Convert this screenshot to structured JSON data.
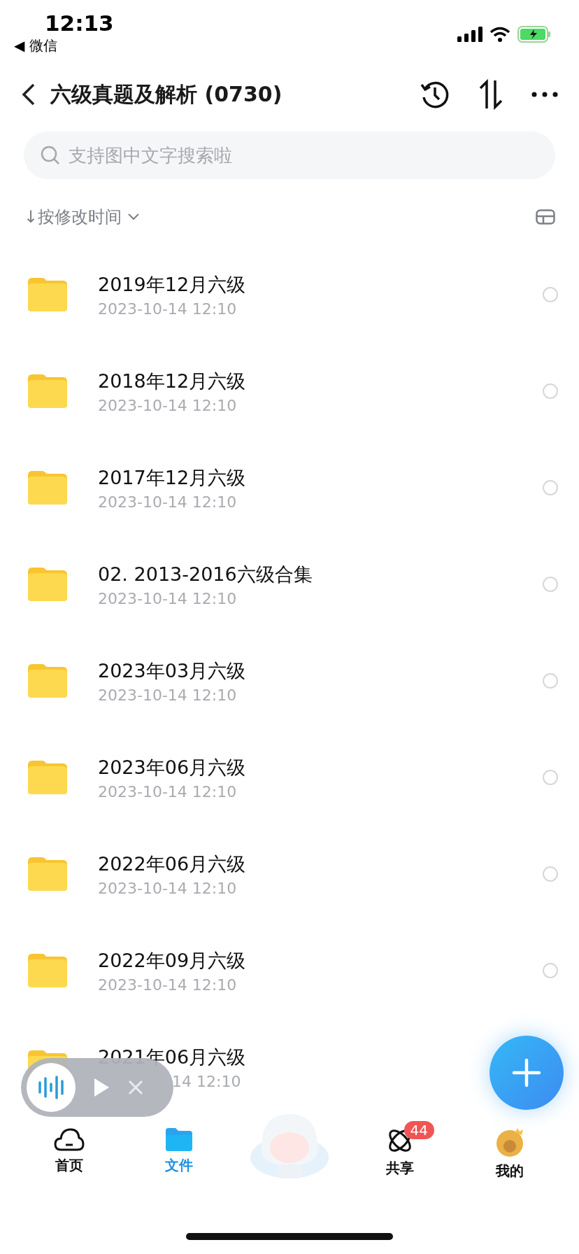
{
  "status_bar": {
    "time": "12:13",
    "back_app": "◀ 微信"
  },
  "header": {
    "title": "六级真题及解析 (0730)"
  },
  "search": {
    "placeholder": "支持图中文字搜索啦"
  },
  "sort": {
    "label": "↓按修改时间"
  },
  "files": [
    {
      "name": "2019年12月六级",
      "date": "2023-10-14 12:10",
      "checked": false
    },
    {
      "name": "2018年12月六级",
      "date": "2023-10-14 12:10",
      "checked": false
    },
    {
      "name": "2017年12月六级",
      "date": "2023-10-14 12:10",
      "checked": false
    },
    {
      "name": "02. 2013-2016六级合集",
      "date": "2023-10-14 12:10",
      "checked": false
    },
    {
      "name": "2023年03月六级",
      "date": "2023-10-14 12:10",
      "checked": false
    },
    {
      "name": "2023年06月六级",
      "date": "2023-10-14 12:10",
      "checked": false
    },
    {
      "name": "2022年06月六级",
      "date": "2023-10-14 12:10",
      "checked": false
    },
    {
      "name": "2022年09月六级",
      "date": "2023-10-14 12:10",
      "checked": false
    },
    {
      "name": "2021年06月六级",
      "date": "14 12:10",
      "partial": true
    }
  ],
  "tab_bar": [
    {
      "kind": "home",
      "label": "首页",
      "selected": false
    },
    {
      "kind": "files",
      "label": "文件",
      "selected": true
    },
    {
      "kind": "mascot",
      "selected": false
    },
    {
      "kind": "share",
      "label": "共享",
      "selected": false,
      "badge": "44"
    },
    {
      "kind": "me",
      "label": "我的",
      "selected": false
    }
  ]
}
